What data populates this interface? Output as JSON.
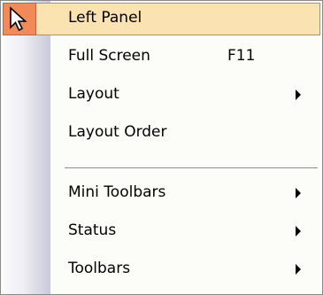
{
  "menu": {
    "items": [
      {
        "label": "Left Panel",
        "shortcut": "",
        "submenu": false,
        "highlighted": true,
        "icon": "cursor-arrow-icon"
      },
      {
        "label": "Full Screen",
        "shortcut": "F11",
        "submenu": false
      },
      {
        "label": "Layout",
        "shortcut": "",
        "submenu": true
      },
      {
        "label": "Layout Order",
        "shortcut": "",
        "submenu": false
      },
      {
        "label": "Mini Toolbars",
        "shortcut": "",
        "submenu": true
      },
      {
        "label": "Status",
        "shortcut": "",
        "submenu": true
      },
      {
        "label": "Toolbars",
        "shortcut": "",
        "submenu": true
      }
    ]
  },
  "colors": {
    "highlight_fill": "#fbe3b1",
    "highlight_border": "#c98b45",
    "icon_background": "#f18a58"
  }
}
